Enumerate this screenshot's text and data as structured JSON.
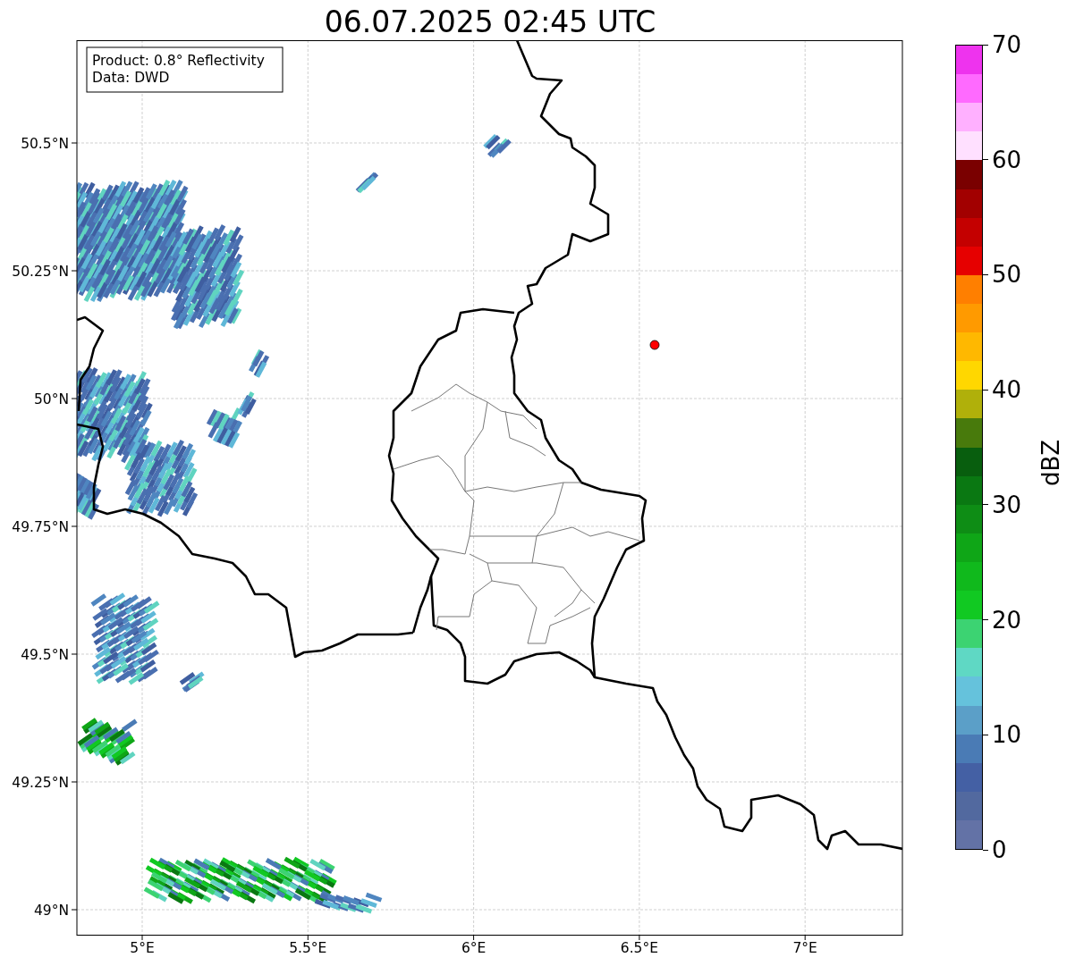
{
  "title": "06.07.2025 02:45 UTC",
  "info": [
    "Product: 0.8° Reflectivity",
    "Data: DWD"
  ],
  "y_ticks": [
    "50.5°N",
    "50.25°N",
    "50°N",
    "49.75°N",
    "49.5°N",
    "49.25°N",
    "49°N"
  ],
  "x_ticks": [
    "5°E",
    "5.5°E",
    "6°E",
    "6.5°E",
    "7°E"
  ],
  "colorbar": {
    "label": "dBZ",
    "ticks": [
      "70",
      "60",
      "50",
      "40",
      "30",
      "20",
      "10",
      "0"
    ],
    "bands": [
      {
        "color": "#ee33ee"
      },
      {
        "color": "#ff6aff"
      },
      {
        "color": "#ffb0ff"
      },
      {
        "color": "#ffe0ff"
      },
      {
        "color": "#7a0000"
      },
      {
        "color": "#a20000"
      },
      {
        "color": "#c40000"
      },
      {
        "color": "#e60000"
      },
      {
        "color": "#ff7f00"
      },
      {
        "color": "#ff9a00"
      },
      {
        "color": "#ffb800"
      },
      {
        "color": "#ffd700"
      },
      {
        "color": "#b0b00a"
      },
      {
        "color": "#487a0c"
      },
      {
        "color": "#085e0e"
      },
      {
        "color": "#0a7812"
      },
      {
        "color": "#0e8d15"
      },
      {
        "color": "#0fa617"
      },
      {
        "color": "#10b91c"
      },
      {
        "color": "#11c922"
      },
      {
        "color": "#3cd372"
      },
      {
        "color": "#5fd8c4"
      },
      {
        "color": "#65c2dc"
      },
      {
        "color": "#5b9fc8"
      },
      {
        "color": "#4a7bb5"
      },
      {
        "color": "#4460a4"
      },
      {
        "color": "#52699f"
      },
      {
        "color": "#6372a6"
      }
    ]
  }
}
